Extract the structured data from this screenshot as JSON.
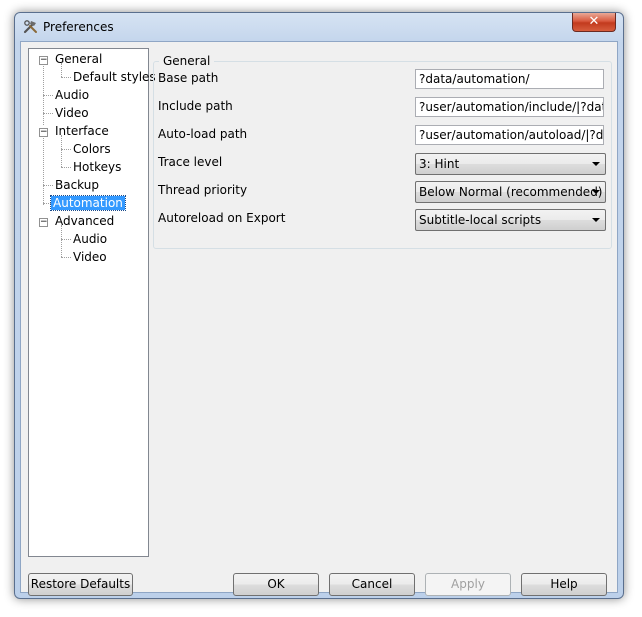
{
  "window": {
    "title": "Preferences",
    "close_glyph": "✕",
    "icon": "tools-icon"
  },
  "tree": {
    "items": [
      {
        "label": "General",
        "level": 0,
        "expander": "−"
      },
      {
        "label": "Default styles",
        "level": 1
      },
      {
        "label": "Audio",
        "level": 0
      },
      {
        "label": "Video",
        "level": 0
      },
      {
        "label": "Interface",
        "level": 0,
        "expander": "−"
      },
      {
        "label": "Colors",
        "level": 1
      },
      {
        "label": "Hotkeys",
        "level": 1
      },
      {
        "label": "Backup",
        "level": 0
      },
      {
        "label": "Automation",
        "level": 0,
        "selected": true
      },
      {
        "label": "Advanced",
        "level": 0,
        "expander": "−"
      },
      {
        "label": "Audio",
        "level": 1
      },
      {
        "label": "Video",
        "level": 1
      }
    ]
  },
  "group": {
    "title": "General",
    "fields": [
      {
        "label": "Base path",
        "type": "text",
        "value": "?data/automation/"
      },
      {
        "label": "Include path",
        "type": "text",
        "value": "?user/automation/include/|?data/automation/include/"
      },
      {
        "label": "Auto-load path",
        "type": "text",
        "value": "?user/automation/autoload/|?data/automation/autoload/"
      },
      {
        "label": "Trace level",
        "type": "select",
        "value": "3: Hint"
      },
      {
        "label": "Thread priority",
        "type": "select",
        "value": "Below Normal (recommended)"
      },
      {
        "label": "Autoreload on Export",
        "type": "select",
        "value": "Subtitle-local scripts"
      }
    ]
  },
  "buttons": {
    "restore_defaults": "Restore Defaults",
    "ok": "OK",
    "cancel": "Cancel",
    "apply": "Apply",
    "help": "Help"
  },
  "colors": {
    "selection": "#3399ff",
    "close_button": "#c23a1e",
    "frame": "#bcd0ea"
  }
}
